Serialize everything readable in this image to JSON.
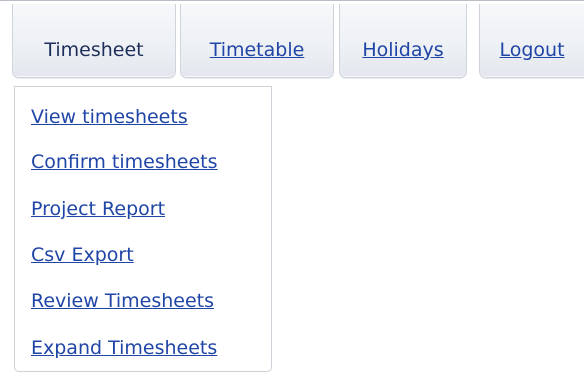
{
  "nav": {
    "tabs": [
      {
        "label": "Timesheet",
        "active": true
      },
      {
        "label": "Timetable",
        "active": false
      },
      {
        "label": "Holidays",
        "active": false
      },
      {
        "label": "Logout",
        "active": false
      }
    ]
  },
  "dropdown": {
    "items": [
      {
        "label": "View timesheets"
      },
      {
        "label": "Confirm timesheets"
      },
      {
        "label": "Project Report"
      },
      {
        "label": "Csv Export"
      },
      {
        "label": "Review Timesheets"
      },
      {
        "label": "Expand Timesheets"
      }
    ]
  },
  "colors": {
    "link": "#1f45a6",
    "active_tab_text": "#1d2e5a",
    "tab_border": "#cfd4dc"
  }
}
